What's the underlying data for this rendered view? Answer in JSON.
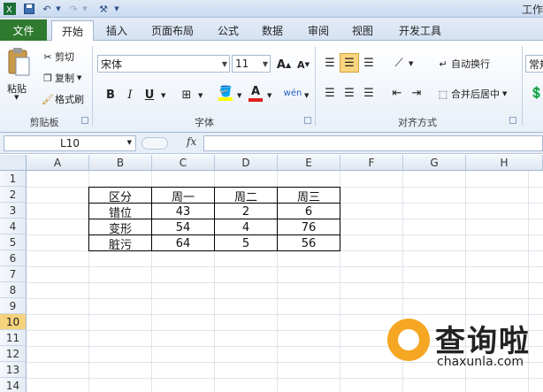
{
  "title_bar": {
    "title": "工作"
  },
  "tabs": [
    "文件",
    "开始",
    "插入",
    "页面布局",
    "公式",
    "数据",
    "审阅",
    "视图",
    "开发工具"
  ],
  "active_tab": "开始",
  "clipboard": {
    "paste_label": "粘贴",
    "cut_label": "剪切",
    "copy_label": "复制",
    "format_painter_label": "格式刷",
    "group_label": "剪贴板"
  },
  "font": {
    "font_name": "宋体",
    "font_size": "11",
    "grow_glyph": "A",
    "shrink_glyph": "A",
    "bold": "B",
    "italic": "I",
    "underline": "U",
    "color_glyph": "A",
    "phonetic_glyph": "wén",
    "group_label": "字体"
  },
  "alignment": {
    "wrap_label": "自动换行",
    "merge_label": "合并后居中",
    "group_label": "对齐方式"
  },
  "number": {
    "format": "常规"
  },
  "formula_bar": {
    "name_box": "L10",
    "fx": "fx",
    "formula": ""
  },
  "colors": {
    "accent": "#2f7a2f",
    "selected_row": "#f6d27c",
    "watermark": "#f5a623"
  },
  "columns": [
    "A",
    "B",
    "C",
    "D",
    "E",
    "F",
    "G",
    "H"
  ],
  "rows": [
    "1",
    "2",
    "3",
    "4",
    "5",
    "6",
    "7",
    "8",
    "9",
    "10",
    "11",
    "12",
    "13",
    "14"
  ],
  "selected_row": "10",
  "table": {
    "headers": [
      "区分",
      "周一",
      "周二",
      "周三"
    ],
    "rows": [
      [
        "错位",
        "43",
        "2",
        "6"
      ],
      [
        "变形",
        "54",
        "4",
        "76"
      ],
      [
        "脏污",
        "64",
        "5",
        "56"
      ]
    ]
  },
  "watermark": {
    "text": "查询啦",
    "url": "chaxunla.com"
  }
}
